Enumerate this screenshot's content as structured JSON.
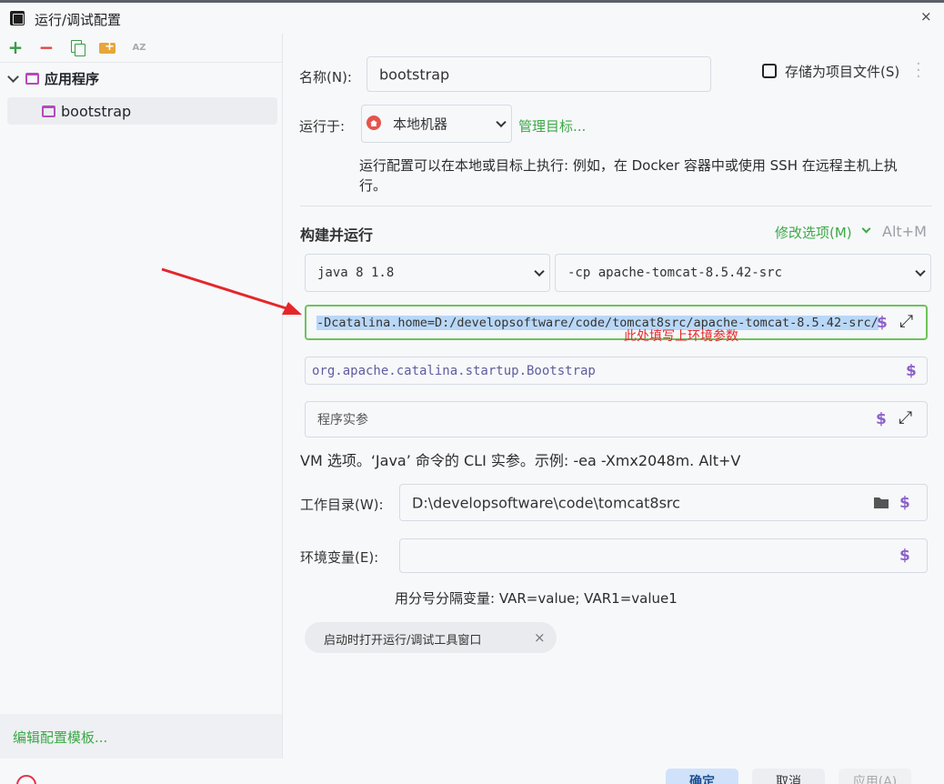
{
  "window": {
    "title": "运行/调试配置",
    "close": "×"
  },
  "toolbar": {
    "add": "+",
    "remove": "−",
    "sort": "AZ"
  },
  "tree": {
    "root_label": "应用程序",
    "child_label": "bootstrap"
  },
  "edit_templates": "编辑配置模板...",
  "form": {
    "name_label": "名称(N):",
    "name_value": "bootstrap",
    "store_label": "存储为项目文件(S)",
    "run_on_label": "运行于:",
    "run_on_value": "本地机器",
    "manage_targets": "管理目标...",
    "run_on_help_1": "运行配置可以在本地或目标上执行: 例如，在 Docker 容器中或使用 SSH 在远程主机上执",
    "run_on_help_2": "行。",
    "section_title": "构建并运行",
    "modify_options": "修改选项(M)",
    "modify_shortcut": "Alt+M",
    "jdk_value": "java 8  1.8",
    "cp_value": "-cp  apache-tomcat-8.5.42-src",
    "vm_options_value": "-Dcatalina.home=D:/developsoftware/code/tomcat8src/apache-tomcat-8.5.42-src/",
    "annotation": "此处填写上环境参数",
    "main_class_value": "org.apache.catalina.startup.Bootstrap",
    "program_args_placeholder": "程序实参",
    "vm_help": "VM 选项。‘Java’ 命令的 CLI 实参。示例: -ea -Xmx2048m. Alt+V",
    "workdir_label": "工作目录(W):",
    "workdir_value": "D:\\developsoftware\\code\\tomcat8src",
    "env_label": "环境变量(E):",
    "env_value": "",
    "env_help": "用分号分隔变量: VAR=value; VAR1=value1",
    "chip_label": "启动时打开运行/调试工具窗口",
    "chip_close": "×",
    "dollar": "$"
  },
  "buttons": {
    "ok": "确定",
    "cancel": "取消",
    "apply": "应用(A)"
  },
  "colors": {
    "accent_green": "#3ca848",
    "macro_purple": "#8c62c9",
    "annotation_red": "#e8262a",
    "selection_blue": "#b9d7f7"
  }
}
